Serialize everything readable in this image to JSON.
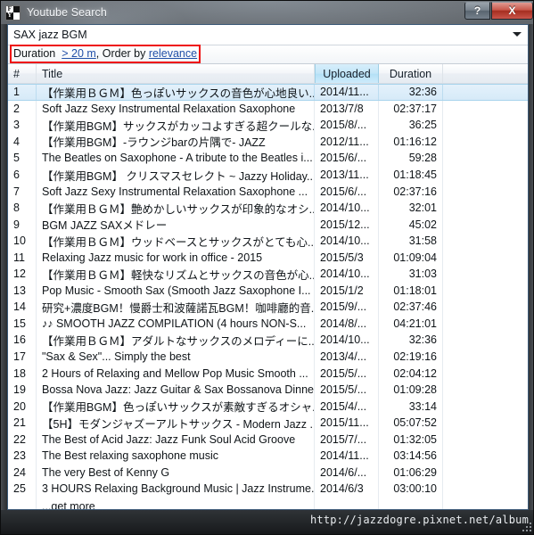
{
  "window": {
    "title": "Youtube Search",
    "icon": "youtube-downloader-icon",
    "icon_letters": [
      "F",
      "",
      "Y",
      ""
    ],
    "help_label": "?",
    "close_label": "X"
  },
  "search": {
    "value": "SAX jazz BGM",
    "placeholder": "SAX jazz BGM",
    "dropdown_icon": "chevron-down-icon"
  },
  "filter": {
    "duration_label": "Duration",
    "duration_value": "> 20 m",
    "separator": ", ",
    "order_label": "Order by",
    "order_value": "relevance",
    "highlight_color": "#ee1111"
  },
  "table": {
    "columns": [
      {
        "key": "num",
        "label": "#",
        "highlighted": false
      },
      {
        "key": "title",
        "label": "Title",
        "highlighted": false
      },
      {
        "key": "up",
        "label": "Uploaded",
        "highlighted": true
      },
      {
        "key": "dur",
        "label": "Duration",
        "highlighted": false
      }
    ],
    "rows": [
      {
        "num": "1",
        "title": "【作業用ＢＧＭ】色っぽいサックスの音色が心地良い...",
        "uploaded": "2014/11...",
        "duration": "32:36",
        "selected": true
      },
      {
        "num": "2",
        "title": "Soft Jazz Sexy  Instrumental Relaxation Saxophone",
        "uploaded": "2013/7/8",
        "duration": "02:37:17",
        "selected": false
      },
      {
        "num": "3",
        "title": "【作業用BGM】サックスがカッコよすぎる超クールな...",
        "uploaded": "2015/8/...",
        "duration": "36:25",
        "selected": false
      },
      {
        "num": "4",
        "title": "【作業用BGM】-ラウンジbarの片隅で- JAZZ",
        "uploaded": "2012/11...",
        "duration": "01:16:12",
        "selected": false
      },
      {
        "num": "5",
        "title": "The Beatles on Saxophone - A tribute to the Beatles i...",
        "uploaded": "2015/6/...",
        "duration": "59:28",
        "selected": false
      },
      {
        "num": "6",
        "title": "【作業用BGM】 クリスマスセレクト ~ Jazzy Holiday...",
        "uploaded": "2013/11...",
        "duration": "01:18:45",
        "selected": false
      },
      {
        "num": "7",
        "title": "Soft Jazz Sexy  Instrumental Relaxation Saxophone ...",
        "uploaded": "2015/6/...",
        "duration": "02:37:16",
        "selected": false
      },
      {
        "num": "8",
        "title": "【作業用ＢＧＭ】艶めかしいサックスが印象的なオシ...",
        "uploaded": "2014/10...",
        "duration": "32:01",
        "selected": false
      },
      {
        "num": "9",
        "title": "BGM JAZZ  SAXメドレー",
        "uploaded": "2015/12...",
        "duration": "45:02",
        "selected": false
      },
      {
        "num": "10",
        "title": "【作業用ＢＧＭ】ウッドベースとサックスがとても心...",
        "uploaded": "2014/10...",
        "duration": "31:58",
        "selected": false
      },
      {
        "num": "11",
        "title": "Relaxing Jazz music for work in office - 2015",
        "uploaded": "2015/5/3",
        "duration": "01:09:04",
        "selected": false
      },
      {
        "num": "12",
        "title": "【作業用ＢＧＭ】軽快なリズムとサックスの音色が心...",
        "uploaded": "2014/10...",
        "duration": "31:03",
        "selected": false
      },
      {
        "num": "13",
        "title": "Pop Music - Smooth Sax (Smooth Jazz Saxophone I...",
        "uploaded": "2015/1/2",
        "duration": "01:18:01",
        "selected": false
      },
      {
        "num": "14",
        "title": "研究+濃度BGM！慢爵士和波薩諾瓦BGM！咖啡廳的音...",
        "uploaded": "2015/9/...",
        "duration": "02:37:46",
        "selected": false
      },
      {
        "num": "15",
        "title": "♪♪ SMOOTH JAZZ COMPILATION (4 hours NON-S...",
        "uploaded": "2014/8/...",
        "duration": "04:21:01",
        "selected": false
      },
      {
        "num": "16",
        "title": "【作業用ＢＧＭ】アダルトなサックスのメロディーに...",
        "uploaded": "2014/10...",
        "duration": "32:36",
        "selected": false
      },
      {
        "num": "17",
        "title": "\"Sax & Sex\"... Simply the best",
        "uploaded": "2013/4/...",
        "duration": "02:19:16",
        "selected": false
      },
      {
        "num": "18",
        "title": "2 Hours of Relaxing and Mellow Pop Music Smooth ...",
        "uploaded": "2015/5/...",
        "duration": "02:04:12",
        "selected": false
      },
      {
        "num": "19",
        "title": "Bossa Nova Jazz: Jazz Guitar & Sax Bossanova Dinne...",
        "uploaded": "2015/5/...",
        "duration": "01:09:28",
        "selected": false
      },
      {
        "num": "20",
        "title": "【作業用BGM】色っぽいサックスが素敵すぎるオシャ...",
        "uploaded": "2015/4/...",
        "duration": "33:14",
        "selected": false
      },
      {
        "num": "21",
        "title": "【5H】モダンジャズーアルトサックス - Modern Jazz ...",
        "uploaded": "2015/11...",
        "duration": "05:07:52",
        "selected": false
      },
      {
        "num": "22",
        "title": "The Best of Acid Jazz: Jazz Funk Soul Acid Groove",
        "uploaded": "2015/7/...",
        "duration": "01:32:05",
        "selected": false
      },
      {
        "num": "23",
        "title": "The Best relaxing saxophone music",
        "uploaded": "2014/11...",
        "duration": "03:14:56",
        "selected": false
      },
      {
        "num": "24",
        "title": "The very Best of Kenny G",
        "uploaded": "2014/6/...",
        "duration": "01:06:29",
        "selected": false
      },
      {
        "num": "25",
        "title": "3 HOURS Relaxing Background Music | Jazz Instrume...",
        "uploaded": "2014/6/3",
        "duration": "03:00:10",
        "selected": false
      }
    ],
    "get_more_label": "...get more"
  },
  "statusbar": {
    "url": "http://jazzdogre.pixnet.net/album",
    "grip_icon": "resize-grip-icon"
  }
}
